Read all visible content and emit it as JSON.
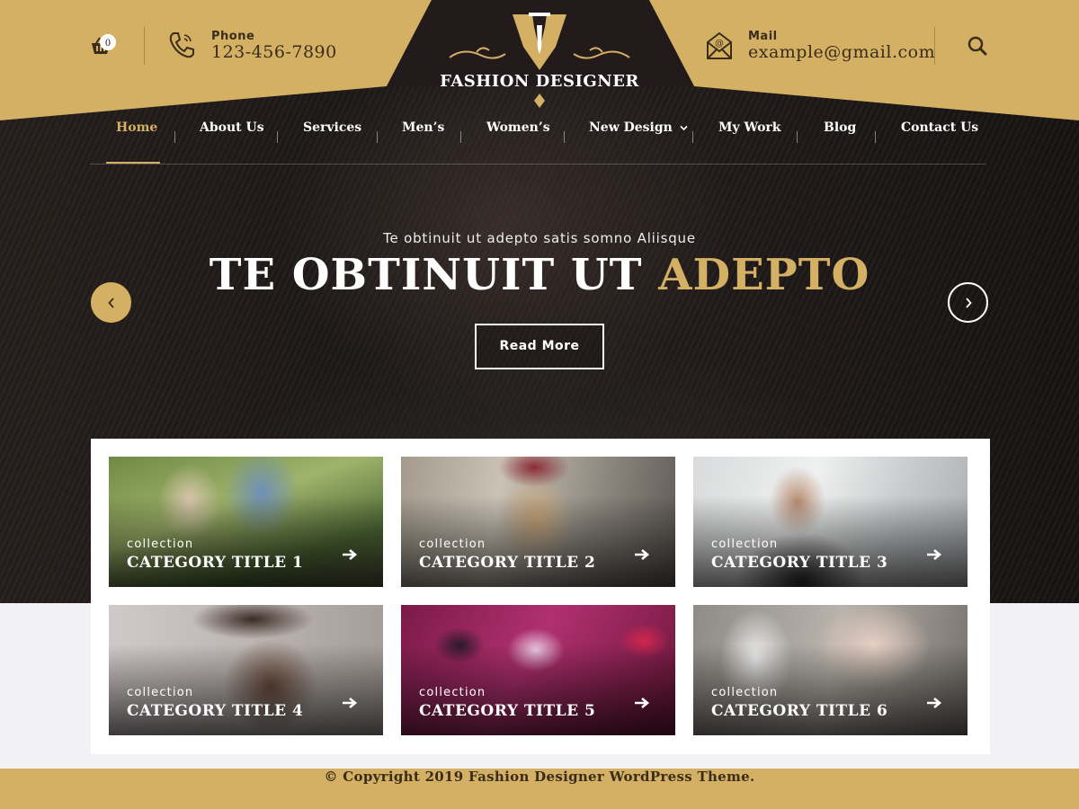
{
  "header": {
    "cart_count": "0",
    "phone": {
      "label": "Phone",
      "value": "123-456-7890"
    },
    "mail": {
      "label": "Mail",
      "value": "example@gmail.com"
    },
    "logo_text": "FASHION DESIGNER",
    "colors": {
      "gold": "#d3b063",
      "dark": "#231a1c"
    }
  },
  "nav": {
    "items": [
      {
        "label": "Home",
        "active": true
      },
      {
        "label": "About Us"
      },
      {
        "label": "Services"
      },
      {
        "label": "Men’s"
      },
      {
        "label": "Women’s"
      },
      {
        "label": "New Design",
        "has_dropdown": true
      },
      {
        "label": "My Work"
      },
      {
        "label": "Blog"
      },
      {
        "label": "Contact Us"
      }
    ]
  },
  "slider": {
    "subtitle": "Te obtinuit ut adepto satis somno Aliisque",
    "title_main": "TE OBTINUIT UT",
    "title_accent": "ADEPTO",
    "button": "Read More"
  },
  "categories": [
    {
      "small": "collection",
      "title": "CATEGORY TITLE 1"
    },
    {
      "small": "collection",
      "title": "CATEGORY TITLE 2"
    },
    {
      "small": "collection",
      "title": "CATEGORY TITLE 3"
    },
    {
      "small": "collection",
      "title": "CATEGORY TITLE 4"
    },
    {
      "small": "collection",
      "title": "CATEGORY TITLE 5"
    },
    {
      "small": "collection",
      "title": "CATEGORY TITLE 6"
    }
  ],
  "footer": {
    "copyright": "© Copyright 2019 Fashion Designer WordPress Theme."
  }
}
